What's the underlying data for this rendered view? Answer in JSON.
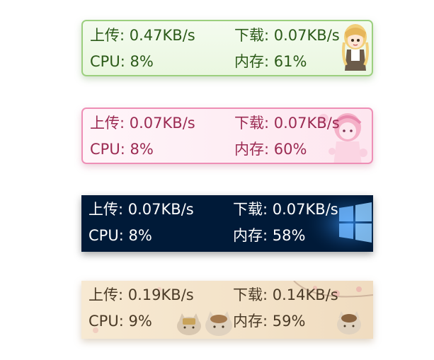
{
  "widgets": [
    {
      "skin": "green",
      "upload_label": "上传:",
      "upload_value": "0.47KB/s",
      "download_label": "下载:",
      "download_value": "0.07KB/s",
      "cpu_label": "CPU:",
      "cpu_value": "8%",
      "memory_label": "内存:",
      "memory_value": "61%",
      "color": "#2b5a18"
    },
    {
      "skin": "pink",
      "upload_label": "上传:",
      "upload_value": "0.07KB/s",
      "download_label": "下载:",
      "download_value": "0.07KB/s",
      "cpu_label": "CPU:",
      "cpu_value": "8%",
      "memory_label": "内存:",
      "memory_value": "60%",
      "color": "#9b2a52"
    },
    {
      "skin": "dark-blue",
      "upload_label": "上传:",
      "upload_value": "0.07KB/s",
      "download_label": "下载:",
      "download_value": "0.07KB/s",
      "cpu_label": "CPU:",
      "cpu_value": "8%",
      "memory_label": "内存:",
      "memory_value": "58%",
      "color": "#ffffff"
    },
    {
      "skin": "beige",
      "upload_label": "上传:",
      "upload_value": "0.19KB/s",
      "download_label": "下载:",
      "download_value": "0.14KB/s",
      "cpu_label": "CPU:",
      "cpu_value": "9%",
      "memory_label": "内存:",
      "memory_value": "59%",
      "color": "#4a3a26"
    }
  ]
}
